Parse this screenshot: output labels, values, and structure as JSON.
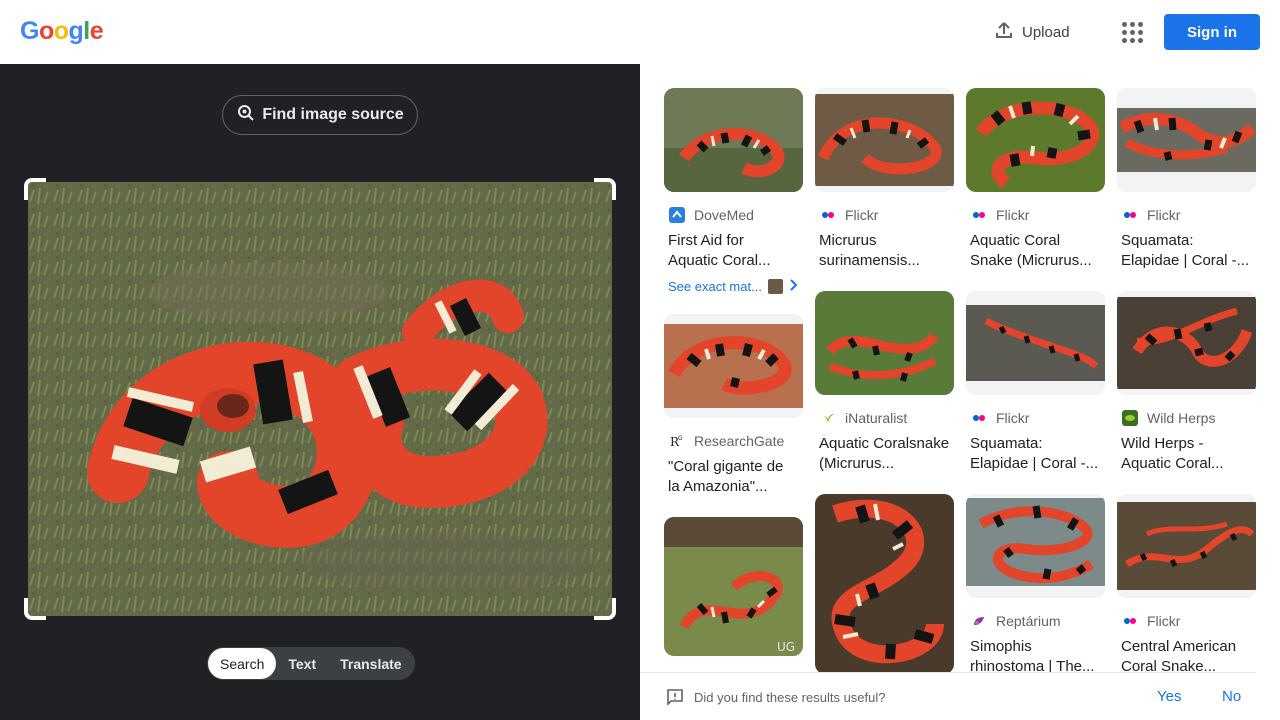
{
  "header": {
    "logo_letters": [
      {
        "ch": "G",
        "color": "#4285F4"
      },
      {
        "ch": "o",
        "color": "#EA4335"
      },
      {
        "ch": "o",
        "color": "#FBBC05"
      },
      {
        "ch": "g",
        "color": "#4285F4"
      },
      {
        "ch": "l",
        "color": "#34A853"
      },
      {
        "ch": "e",
        "color": "#EA4335"
      }
    ],
    "upload_label": "Upload",
    "signin_label": "Sign in"
  },
  "left": {
    "find_source_label": "Find image source",
    "modes": [
      "Search",
      "Text",
      "Translate"
    ],
    "active_mode": "Search"
  },
  "results": [
    {
      "source": "DoveMed",
      "icon": "dovemed-icon",
      "title1": "First Aid for",
      "title2": "Aquatic Coral...",
      "exact": "See exact mat..."
    },
    {
      "source": "ResearchGate",
      "icon": "researchgate-icon",
      "title1": "\"Coral gigante de",
      "title2": "la Amazonia\"..."
    },
    {
      "source": "",
      "icon": "",
      "title1": "",
      "title2": ""
    },
    {
      "source": "Flickr",
      "icon": "flickr-icon",
      "title1": "Micrurus",
      "title2": "surinamensis..."
    },
    {
      "source": "iNaturalist",
      "icon": "inaturalist-icon",
      "title1": "Aquatic Coralsnake",
      "title2": "(Micrurus..."
    },
    {
      "source": "",
      "icon": "",
      "title1": "",
      "title2": ""
    },
    {
      "source": "Flickr",
      "icon": "flickr-icon",
      "title1": "Aquatic Coral",
      "title2": "Snake (Micrurus..."
    },
    {
      "source": "Flickr",
      "icon": "flickr-icon",
      "title1": "Squamata:",
      "title2": "Elapidae | Coral -..."
    },
    {
      "source": "Reptárium",
      "icon": "reptarium-icon",
      "title1": "Simophis",
      "title2": "rhinostoma | The..."
    },
    {
      "source": "Flickr",
      "icon": "flickr-icon",
      "title1": "Squamata:",
      "title2": "Elapidae | Coral -..."
    },
    {
      "source": "Wild Herps",
      "icon": "wildherps-icon",
      "title1": "Wild Herps -",
      "title2": "Aquatic Coral..."
    },
    {
      "source": "Flickr",
      "icon": "flickr-icon",
      "title1": "Central American",
      "title2": "Coral Snake..."
    }
  ],
  "feedback": {
    "question": "Did you find these results useful?",
    "yes": "Yes",
    "no": "No"
  },
  "colors": {
    "accent": "#1a73e8",
    "dark_pane": "#202124",
    "snake_red": "#e2452a",
    "snake_black": "#141414",
    "snake_cream": "#f1ecd3"
  }
}
